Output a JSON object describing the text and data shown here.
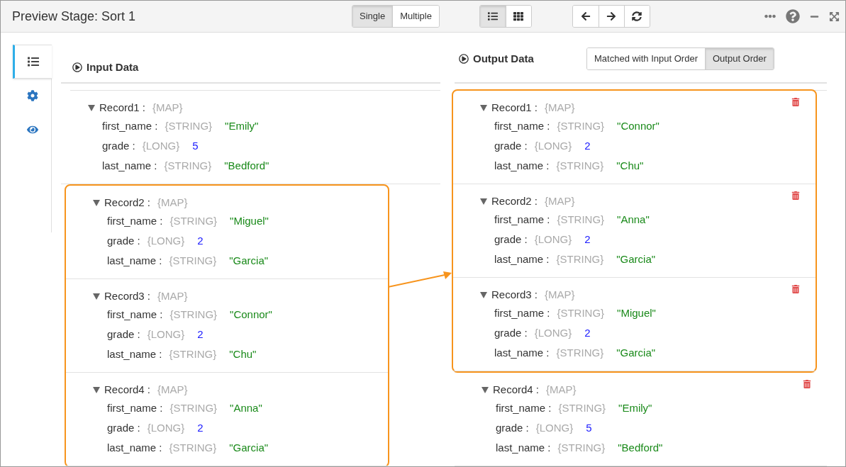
{
  "window": {
    "title": "Preview Stage: Sort 1"
  },
  "mode_toggle": [
    {
      "label": "Single",
      "selected": true
    },
    {
      "label": "Multiple",
      "selected": false
    }
  ],
  "view_toggle": [
    {
      "kind": "list",
      "selected": true
    },
    {
      "kind": "table",
      "selected": false
    }
  ],
  "nav_buttons": [
    {
      "kind": "back"
    },
    {
      "kind": "forward"
    },
    {
      "kind": "refresh"
    }
  ],
  "sidebar": {
    "tabs": [
      {
        "kind": "list",
        "selected": true
      },
      {
        "kind": "settings",
        "selected": false
      },
      {
        "kind": "preview",
        "selected": false
      }
    ]
  },
  "input_data": {
    "title": "Input Data",
    "records": [
      {
        "label": "Record1 :",
        "type": "{MAP}",
        "highlighted": false,
        "fields": [
          {
            "name": "first_name :",
            "type": "{STRING}",
            "kind": "string",
            "value": "\"Emily\""
          },
          {
            "name": "grade :",
            "type": "{LONG}",
            "kind": "number",
            "value": "5"
          },
          {
            "name": "last_name :",
            "type": "{STRING}",
            "kind": "string",
            "value": "\"Bedford\""
          }
        ]
      },
      {
        "label": "Record2 :",
        "type": "{MAP}",
        "highlighted": true,
        "fields": [
          {
            "name": "first_name :",
            "type": "{STRING}",
            "kind": "string",
            "value": "\"Miguel\""
          },
          {
            "name": "grade :",
            "type": "{LONG}",
            "kind": "number",
            "value": "2"
          },
          {
            "name": "last_name :",
            "type": "{STRING}",
            "kind": "string",
            "value": "\"Garcia\""
          }
        ]
      },
      {
        "label": "Record3 :",
        "type": "{MAP}",
        "highlighted": true,
        "fields": [
          {
            "name": "first_name :",
            "type": "{STRING}",
            "kind": "string",
            "value": "\"Connor\""
          },
          {
            "name": "grade :",
            "type": "{LONG}",
            "kind": "number",
            "value": "2"
          },
          {
            "name": "last_name :",
            "type": "{STRING}",
            "kind": "string",
            "value": "\"Chu\""
          }
        ]
      },
      {
        "label": "Record4 :",
        "type": "{MAP}",
        "highlighted": true,
        "fields": [
          {
            "name": "first_name :",
            "type": "{STRING}",
            "kind": "string",
            "value": "\"Anna\""
          },
          {
            "name": "grade :",
            "type": "{LONG}",
            "kind": "number",
            "value": "2"
          },
          {
            "name": "last_name :",
            "type": "{STRING}",
            "kind": "string",
            "value": "\"Garcia\""
          }
        ]
      }
    ]
  },
  "output_data": {
    "title": "Output Data",
    "order_toggle": [
      {
        "label": "Matched with Input Order",
        "selected": false
      },
      {
        "label": "Output Order",
        "selected": true
      }
    ],
    "records": [
      {
        "label": "Record1 :",
        "type": "{MAP}",
        "highlighted": true,
        "fields": [
          {
            "name": "first_name :",
            "type": "{STRING}",
            "kind": "string",
            "value": "\"Connor\""
          },
          {
            "name": "grade :",
            "type": "{LONG}",
            "kind": "number",
            "value": "2"
          },
          {
            "name": "last_name :",
            "type": "{STRING}",
            "kind": "string",
            "value": "\"Chu\""
          }
        ]
      },
      {
        "label": "Record2 :",
        "type": "{MAP}",
        "highlighted": true,
        "fields": [
          {
            "name": "first_name :",
            "type": "{STRING}",
            "kind": "string",
            "value": "\"Anna\""
          },
          {
            "name": "grade :",
            "type": "{LONG}",
            "kind": "number",
            "value": "2"
          },
          {
            "name": "last_name :",
            "type": "{STRING}",
            "kind": "string",
            "value": "\"Garcia\""
          }
        ]
      },
      {
        "label": "Record3 :",
        "type": "{MAP}",
        "highlighted": true,
        "fields": [
          {
            "name": "first_name :",
            "type": "{STRING}",
            "kind": "string",
            "value": "\"Miguel\""
          },
          {
            "name": "grade :",
            "type": "{LONG}",
            "kind": "number",
            "value": "2"
          },
          {
            "name": "last_name :",
            "type": "{STRING}",
            "kind": "string",
            "value": "\"Garcia\""
          }
        ]
      },
      {
        "label": "Record4 :",
        "type": "{MAP}",
        "highlighted": false,
        "fields": [
          {
            "name": "first_name :",
            "type": "{STRING}",
            "kind": "string",
            "value": "\"Emily\""
          },
          {
            "name": "grade :",
            "type": "{LONG}",
            "kind": "number",
            "value": "5"
          },
          {
            "name": "last_name :",
            "type": "{STRING}",
            "kind": "string",
            "value": "\"Bedford\""
          }
        ]
      }
    ]
  }
}
